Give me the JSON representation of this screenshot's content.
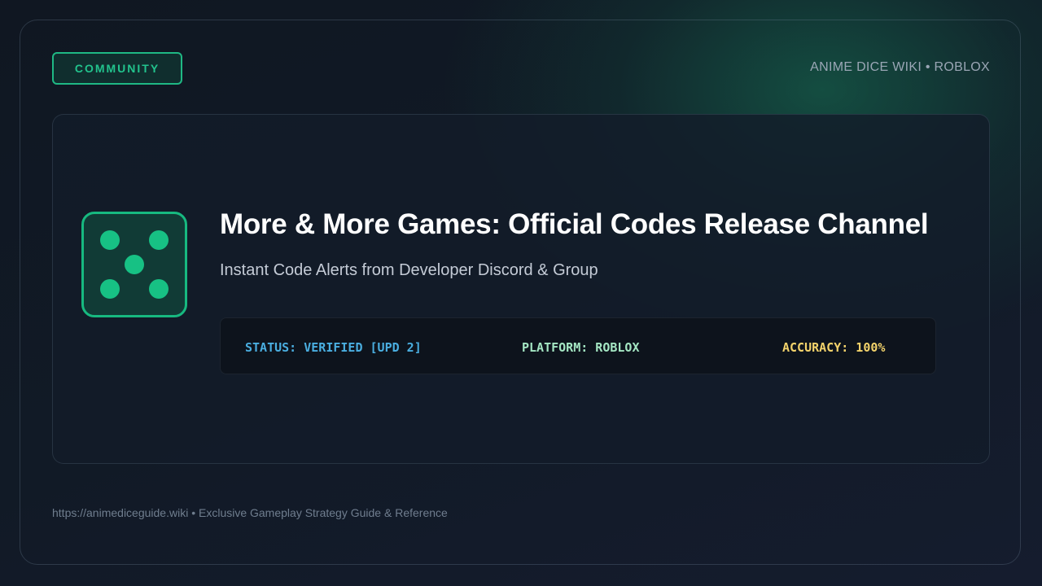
{
  "header": {
    "badge_label": "COMMUNITY",
    "site_label": "ANIME DICE WIKI • ROBLOX"
  },
  "hero": {
    "icon": "dice-five-icon",
    "title": "More & More Games: Official Codes Release Channel",
    "subtitle": "Instant Code Alerts from Developer Discord & Group"
  },
  "status_bar": {
    "status": "STATUS: VERIFIED [UPD 2]",
    "platform": "PLATFORM: ROBLOX",
    "accuracy": "ACCURACY: 100%"
  },
  "footer": {
    "text": "https://animediceguide.wiki • Exclusive Gameplay Strategy Guide & Reference"
  },
  "colors": {
    "accent": "#1fb884",
    "status": "#4aaee0",
    "platform": "#a4e6c3",
    "accuracy": "#f3d36b"
  }
}
